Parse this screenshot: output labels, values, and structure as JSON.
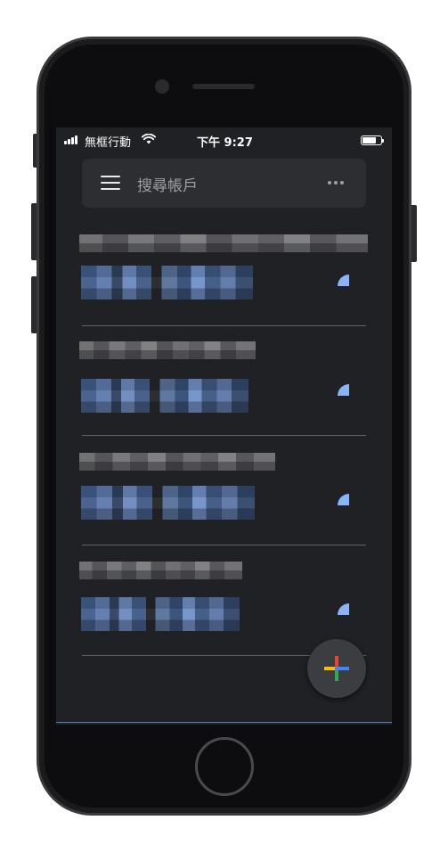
{
  "status_bar": {
    "carrier": "無框行動",
    "time": "下午 9:27",
    "signal_icon": "signal-bars-icon",
    "wifi_icon": "wifi-icon",
    "battery_icon": "battery-icon"
  },
  "search": {
    "placeholder": "搜尋帳戶",
    "menu_icon": "hamburger-menu-icon",
    "more_icon": "more-horizontal-icon"
  },
  "accounts": [
    {
      "name": "████████████████████",
      "code": "███ ███",
      "timer_icon": "countdown-timer-icon"
    },
    {
      "name": "████████████████",
      "code": "███ ███",
      "timer_icon": "countdown-timer-icon"
    },
    {
      "name": "██████████████████",
      "code": "███ ███",
      "timer_icon": "countdown-timer-icon"
    },
    {
      "name": "██████████████",
      "code": "███ ███",
      "timer_icon": "countdown-timer-icon"
    }
  ],
  "fab": {
    "icon": "google-plus-add-icon"
  },
  "colors": {
    "background": "#202124",
    "surface": "#2d2e31",
    "code_blue": "#5b78ab",
    "timer_blue": "#8ab4f8",
    "divider": "#5f6368",
    "plus_red": "#ea4335",
    "plus_blue": "#4285f4",
    "plus_yellow": "#fbbc04",
    "plus_green": "#34a853"
  }
}
